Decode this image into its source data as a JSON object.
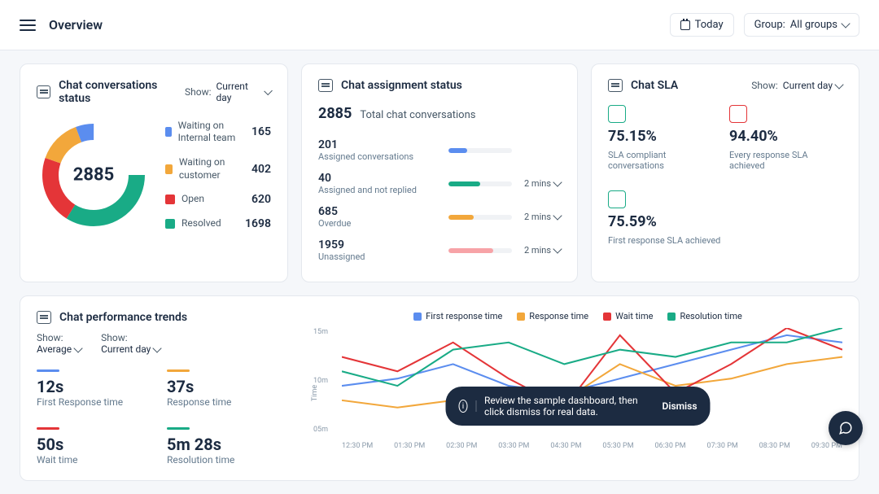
{
  "header": {
    "title": "Overview",
    "date_label": "Today",
    "group_label": "Group:",
    "group_value": "All groups"
  },
  "status_card": {
    "title": "Chat conversations status",
    "show_label": "Show:",
    "show_value": "Current day",
    "total": "2885",
    "items": [
      {
        "label": "Waiting on Internal team",
        "value": "165",
        "color": "#5b8def"
      },
      {
        "label": "Waiting on customer",
        "value": "402",
        "color": "#f2a73b"
      },
      {
        "label": "Open",
        "value": "620",
        "color": "#e43538"
      },
      {
        "label": "Resolved",
        "value": "1698",
        "color": "#19ab86"
      }
    ]
  },
  "assignment_card": {
    "title": "Chat assignment status",
    "total_num": "2885",
    "total_label": "Total chat conversations",
    "rows": [
      {
        "num": "201",
        "label": "Assigned conversations",
        "color": "#5b8def",
        "pct": 30,
        "time": ""
      },
      {
        "num": "40",
        "label": "Assigned and not replied",
        "color": "#19ab86",
        "pct": 50,
        "time": "2 mins"
      },
      {
        "num": "685",
        "label": "Overdue",
        "color": "#f2a73b",
        "pct": 40,
        "time": "2 mins"
      },
      {
        "num": "1959",
        "label": "Unassigned",
        "color": "#f7a3a7",
        "pct": 70,
        "time": "2 mins"
      }
    ]
  },
  "sla_card": {
    "title": "Chat SLA",
    "show_label": "Show:",
    "show_value": "Current day",
    "items": [
      {
        "pct": "75.15%",
        "label": "SLA compliant conversations",
        "icon_color": "#19ab86"
      },
      {
        "pct": "94.40%",
        "label": "Every response SLA achieved",
        "icon_color": "#e43538"
      },
      {
        "pct": "75.59%",
        "label": "First response SLA achieved",
        "icon_color": "#19ab86"
      }
    ]
  },
  "trends_card": {
    "title": "Chat performance trends",
    "show1_label": "Show:",
    "show1_value": "Average",
    "show2_label": "Show:",
    "show2_value": "Current day",
    "metrics": [
      {
        "value": "12s",
        "label": "First Response time",
        "color": "#5b8def"
      },
      {
        "value": "37s",
        "label": "Response time",
        "color": "#f2a73b"
      },
      {
        "value": "50s",
        "label": "Wait time",
        "color": "#e43538"
      },
      {
        "value": "5m 28s",
        "label": "Resolution time",
        "color": "#19ab86"
      }
    ],
    "legend": [
      {
        "label": "First response time",
        "color": "#5b8def"
      },
      {
        "label": "Response time",
        "color": "#f2a73b"
      },
      {
        "label": "Wait time",
        "color": "#e43538"
      },
      {
        "label": "Resolution time",
        "color": "#19ab86"
      }
    ],
    "y_axis": "Time",
    "y_labels": [
      "15m",
      "10m",
      "05m"
    ]
  },
  "chart_data": {
    "type": "line",
    "categories": [
      "12:30 PM",
      "01:30 PM",
      "02:30 PM",
      "03:30 PM",
      "04:30 PM",
      "05:30 PM",
      "06:30 PM",
      "07:30 PM",
      "08:30 PM",
      "09:30 PM"
    ],
    "ylabel": "Time",
    "ylim": [
      0,
      15
    ],
    "series": [
      {
        "name": "First response time",
        "color": "#5b8def",
        "values": [
          7,
          8,
          10,
          7,
          6,
          8,
          10,
          12,
          14,
          13
        ]
      },
      {
        "name": "Response time",
        "color": "#f2a73b",
        "values": [
          5,
          4,
          5,
          6,
          5,
          10,
          7,
          8,
          10,
          11
        ]
      },
      {
        "name": "Wait time",
        "color": "#e43538",
        "values": [
          11,
          9,
          13,
          8,
          4,
          14,
          6,
          10,
          15,
          12
        ]
      },
      {
        "name": "Resolution time",
        "color": "#19ab86",
        "values": [
          9,
          7,
          12,
          13,
          10,
          12,
          11,
          13,
          13,
          15
        ]
      }
    ]
  },
  "toast": {
    "message": "Review the sample dashboard, then click dismiss for real data.",
    "dismiss": "Dismiss"
  }
}
